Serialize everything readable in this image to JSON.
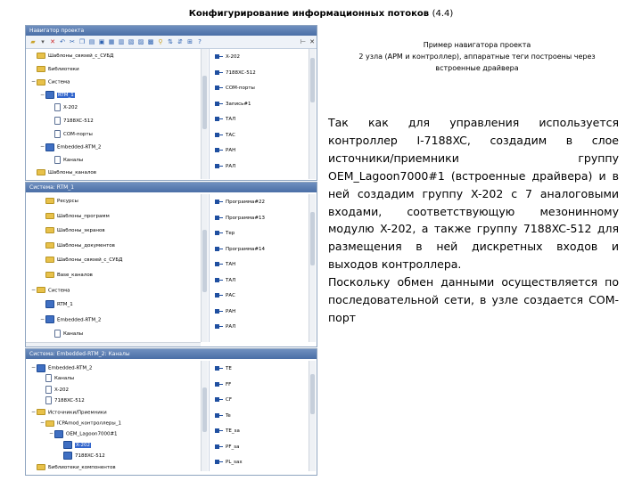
{
  "slide": {
    "title": "Конфигурирование информационных потоков",
    "title_suffix": "(4.4)"
  },
  "screens": {
    "top": {
      "window_title": "Навигатор проекта",
      "tree": [
        {
          "label": "Шаблоны_связей_с_СУБД",
          "icon": "folder"
        },
        {
          "label": "Библиотеки",
          "icon": "folder"
        },
        {
          "label": "Система",
          "icon": "folder",
          "expander": "−"
        },
        {
          "label": "RTM_1",
          "icon": "comp",
          "selected": true,
          "expander": "−"
        },
        {
          "label": "X-202",
          "icon": "doc"
        },
        {
          "label": "7188XC-512",
          "icon": "doc"
        },
        {
          "label": "COM-порты",
          "icon": "doc"
        },
        {
          "label": "Embedded-RTM_2",
          "icon": "comp",
          "expander": "−"
        },
        {
          "label": "Каналы",
          "icon": "doc"
        },
        {
          "label": "Шаблоны_каналов",
          "icon": "folder"
        }
      ],
      "list": [
        "X-202",
        "7188XC-512",
        "COM-порты",
        "Запись#1",
        "ТАЛ",
        "ТАС",
        "РАН",
        "РАЛ"
      ]
    },
    "middle": {
      "window_title": "Система: RTM_1",
      "tree": [
        {
          "label": "Ресурсы",
          "icon": "folder"
        },
        {
          "label": "Шаблоны_программ",
          "icon": "folder"
        },
        {
          "label": "Шаблоны_экранов",
          "icon": "folder"
        },
        {
          "label": "Шаблоны_документов",
          "icon": "folder"
        },
        {
          "label": "Шаблоны_связей_с_СУБД",
          "icon": "folder"
        },
        {
          "label": "Base_каналов",
          "icon": "folder"
        },
        {
          "label": "Система",
          "icon": "folder",
          "expander": "−"
        },
        {
          "label": "RTM_1",
          "icon": "comp"
        },
        {
          "label": "Embedded-RTM_2",
          "icon": "comp",
          "expander": "−"
        },
        {
          "label": "Каналы",
          "icon": "doc"
        }
      ],
      "list": [
        "Программа#22",
        "Программа#13",
        "Тер",
        "Программа#14",
        "ТАН",
        "ТАЛ",
        "РАС",
        "РАН",
        "РАЛ"
      ]
    },
    "bottom": {
      "window_title": "Система: Embedded-RTM_2: Каналы",
      "tree": [
        {
          "label": "Embedded-RTM_2",
          "icon": "comp",
          "expander": "−"
        },
        {
          "label": "Каналы",
          "icon": "doc"
        },
        {
          "label": "X-202",
          "icon": "doc"
        },
        {
          "label": "7188XC-512",
          "icon": "doc"
        },
        {
          "label": "Источники/Приемники",
          "icon": "folder",
          "expander": "−"
        },
        {
          "label": "ICPAmod_контроллеры_1",
          "icon": "folder",
          "expander": "−"
        },
        {
          "label": "OEM_Lagoon7000#1",
          "icon": "comp",
          "expander": "−"
        },
        {
          "label": "X-202",
          "icon": "comp",
          "selected": true
        },
        {
          "label": "7188XC-512",
          "icon": "comp"
        },
        {
          "label": "Библиотеки_компонентов",
          "icon": "folder"
        }
      ],
      "list": [
        "TE",
        "FF",
        "CF",
        "Te",
        "TE_sa",
        "PF_sa",
        "PL_sax"
      ]
    }
  },
  "caption": {
    "line1": "Пример навигатора проекта",
    "line2": "2 узла (АРМ и контроллер), аппаратные теги построены через",
    "line3": "встроенные драйвера"
  },
  "body": {
    "p1": "Так как для управления используется контроллер I-7188XC, создадим в слое источники/приемники группу OEM_Lagoon7000#1 (встроенные драйвера) и в ней создадим группу X-202 с 7 аналоговыми входами, соответствующую мезонинному модулю X-202, а также группу 7188XC-512 для размещения в ней дискретных входов и выходов контроллера.",
    "p2": "Поскольку обмен данными осуществляется по последовательной сети, в узле создается COM-порт"
  },
  "colors": {
    "title_bar": "#4a6ea6",
    "selection": "#3366cc",
    "folder_icon": "#e8c14a",
    "tag_icon": "#1f4fa0"
  }
}
